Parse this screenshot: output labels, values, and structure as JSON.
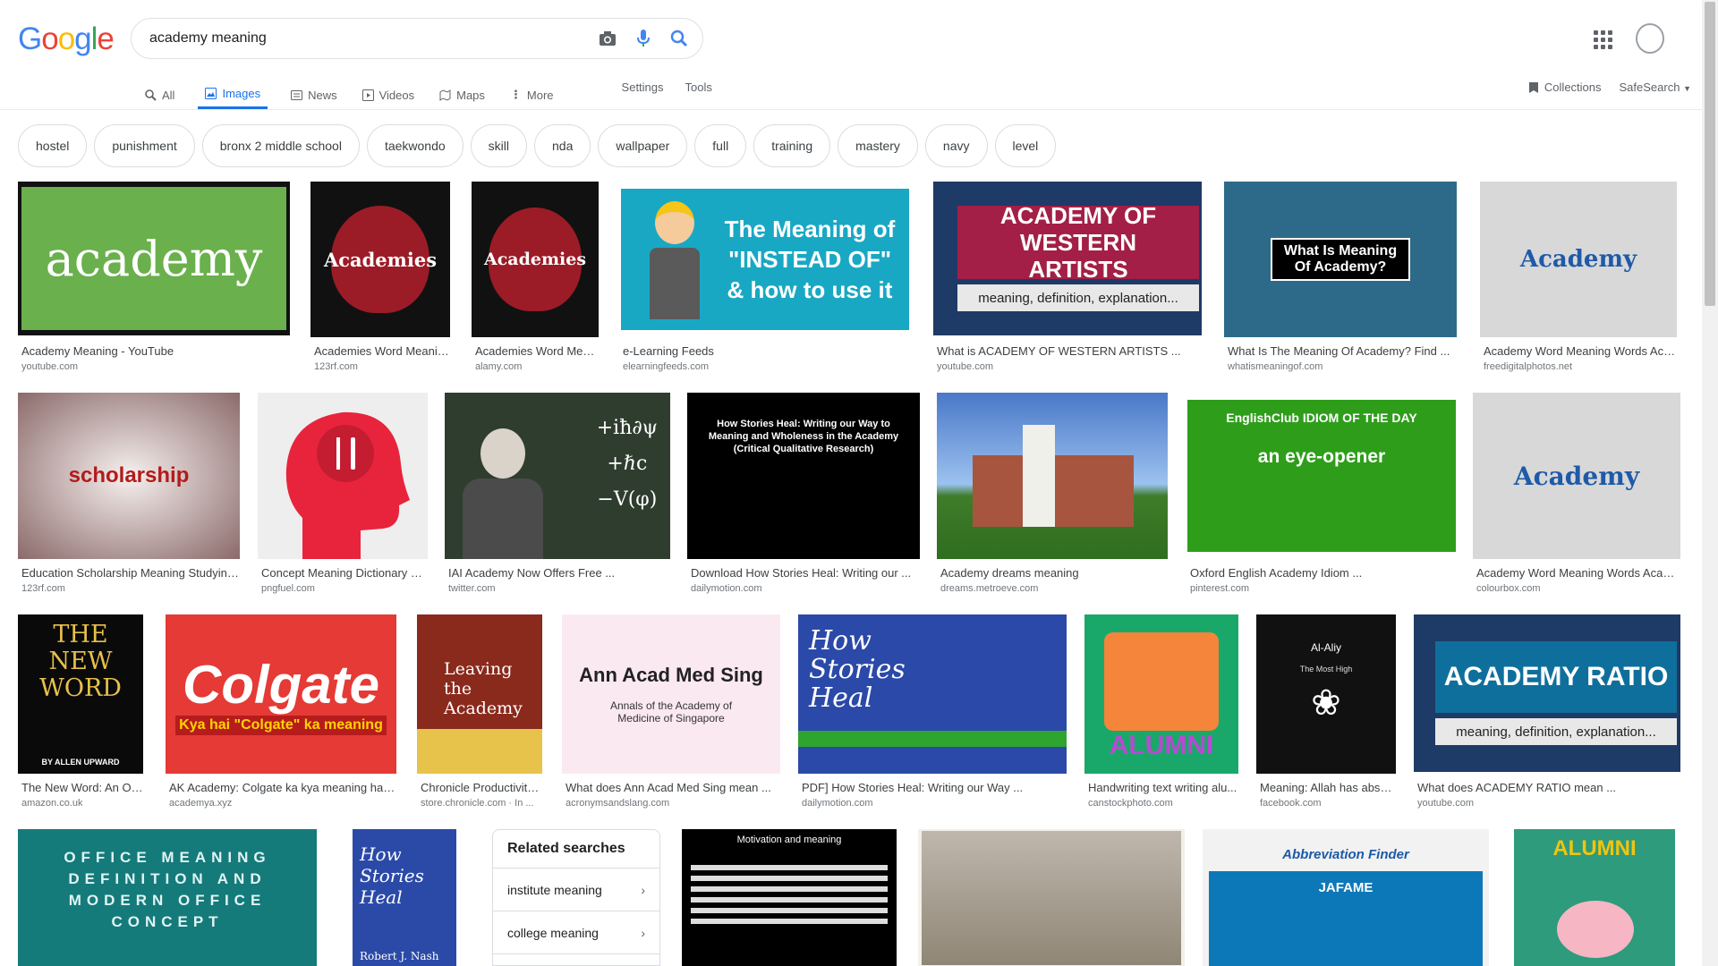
{
  "logo": "Google",
  "search": {
    "query": "academy meaning"
  },
  "nav": {
    "tabs": [
      "All",
      "Images",
      "News",
      "Videos",
      "Maps",
      "More"
    ],
    "settings": "Settings",
    "tools": "Tools",
    "collections": "Collections",
    "safesearch": "SafeSearch"
  },
  "chips": [
    "hostel",
    "punishment",
    "bronx 2 middle school",
    "taekwondo",
    "skill",
    "nda",
    "wallpaper",
    "full",
    "training",
    "mastery",
    "navy",
    "level"
  ],
  "results": [
    {
      "caption": "Academy Meaning - YouTube",
      "source": "youtube.com",
      "art": "academy"
    },
    {
      "caption": "Academies Word Meanin...",
      "source": "123rf.com",
      "art": "Academies"
    },
    {
      "caption": "Academies Word Mean...",
      "source": "alamy.com",
      "art": "Academies"
    },
    {
      "caption": "e-Learning Feeds",
      "source": "elearningfeeds.com",
      "art": "The Meaning of \"INSTEAD OF\" & how to use it"
    },
    {
      "caption": "What is ACADEMY OF WESTERN ARTISTS ...",
      "source": "youtube.com",
      "art": "ACADEMY OF WESTERN ARTISTS",
      "art2": "meaning, definition, explanation..."
    },
    {
      "caption": "What Is The Meaning Of Academy? Find ...",
      "source": "whatismeaningof.com",
      "art": "What Is Meaning Of Academy?"
    },
    {
      "caption": "Academy Word Meaning Words Acad...",
      "source": "freedigitalphotos.net",
      "art": "Academy"
    },
    {
      "caption": "Education Scholarship Meaning Studying...",
      "source": "123rf.com",
      "art": "scholarship"
    },
    {
      "caption": "Concept Meaning Dictionary D...",
      "source": "pngfuel.com",
      "art": ""
    },
    {
      "caption": "IAI Academy Now Offers Free ...",
      "source": "twitter.com",
      "art": ""
    },
    {
      "caption": "Download How Stories Heal: Writing our ...",
      "source": "dailymotion.com",
      "art": "How Stories Heal: Writing our Way to Meaning and Wholeness in the Academy (Critical Qualitative Research)"
    },
    {
      "caption": "Academy dreams meaning",
      "source": "dreams.metroeve.com",
      "art": ""
    },
    {
      "caption": "Oxford English Academy Idiom ...",
      "source": "pinterest.com",
      "art": "EnglishClub IDIOM OF THE DAY",
      "art2": "an eye-opener"
    },
    {
      "caption": "Academy Word Meaning Words Acade...",
      "source": "colourbox.com",
      "art": "Academy"
    },
    {
      "caption": "The New Word: An Op...",
      "source": "amazon.co.uk",
      "art": "THE NEW WORD",
      "art2": "BY ALLEN UPWARD"
    },
    {
      "caption": "AK Academy: Colgate ka kya meaning hai ...",
      "source": "academya.xyz",
      "art": "Colgate",
      "art2": "Kya hai \"Colgate\" ka meaning"
    },
    {
      "caption": "Chronicle Productivity ...",
      "source": "store.chronicle.com · In ...",
      "art": "Leaving the Academy"
    },
    {
      "caption": "What does Ann Acad Med Sing mean ...",
      "source": "acronymsandslang.com",
      "art": "Ann Acad Med Sing",
      "art2": "Annals of the Academy of Medicine of Singapore"
    },
    {
      "caption": "PDF] How Stories Heal: Writing our Way ...",
      "source": "dailymotion.com",
      "art": "How Stories Heal"
    },
    {
      "caption": "Handwriting text writing alu...",
      "source": "canstockphoto.com",
      "art": "ALUMNI"
    },
    {
      "caption": "Meaning: Allah has abso...",
      "source": "facebook.com",
      "art": "Al-Aliy",
      "art2": "The Most High"
    },
    {
      "caption": "What does ACADEMY RATIO mean ...",
      "source": "youtube.com",
      "art": "ACADEMY RATIO",
      "art2": "meaning, definition, explanation..."
    },
    {
      "caption": "",
      "source": "",
      "art": "OFFICE MEANING DEFINITION AND MODERN OFFICE CONCEPT"
    },
    {
      "caption": "",
      "source": "",
      "art": "How Stories Heal",
      "art2": "Robert J. Nash"
    },
    {
      "caption": "",
      "source": "",
      "art": "Motivation and meaning"
    },
    {
      "caption": "",
      "source": "",
      "art": ""
    },
    {
      "caption": "",
      "source": "",
      "art": "Abbreviation Finder",
      "art2": "JAFAME"
    },
    {
      "caption": "",
      "source": "",
      "art": "ALUMNI"
    }
  ],
  "related": {
    "title": "Related searches",
    "items": [
      "institute meaning",
      "college meaning"
    ]
  }
}
